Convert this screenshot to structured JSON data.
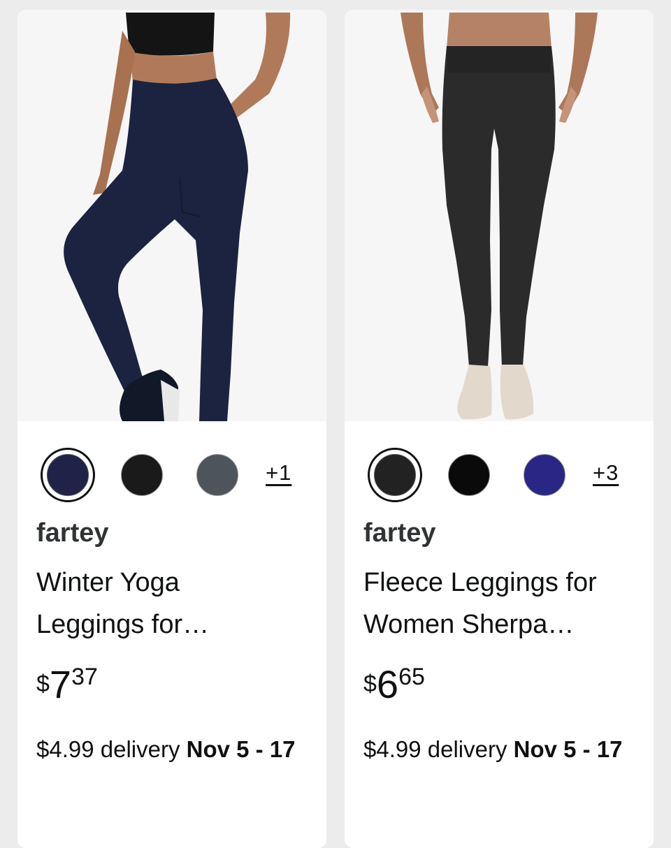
{
  "products": [
    {
      "image_alt": "leggings-navy",
      "swatches": [
        {
          "name": "navy",
          "color": "#1e2347",
          "selected": true
        },
        {
          "name": "black",
          "color": "#1a1a1a",
          "selected": false
        },
        {
          "name": "gray",
          "color": "#4d545b",
          "selected": false
        }
      ],
      "more_colors": "+1",
      "brand": "fartey",
      "title_line1": "Winter Yoga",
      "title_line2": "Leggings for…",
      "price_symbol": "$",
      "price_whole": "7",
      "price_fraction": "37",
      "delivery_cost": "$4.99 delivery",
      "delivery_dates": "Nov 5 - 17"
    },
    {
      "image_alt": "leggings-charcoal",
      "swatches": [
        {
          "name": "charcoal",
          "color": "#222222",
          "selected": true
        },
        {
          "name": "black",
          "color": "#0a0a0a",
          "selected": false
        },
        {
          "name": "royal-blue",
          "color": "#2a2685",
          "selected": false
        }
      ],
      "more_colors": "+3",
      "brand": "fartey",
      "title_line1": "Fleece Leggings for",
      "title_line2": "Women Sherpa…",
      "price_symbol": "$",
      "price_whole": "6",
      "price_fraction": "65",
      "delivery_cost": "$4.99 delivery",
      "delivery_dates": "Nov 5 - 17"
    }
  ]
}
